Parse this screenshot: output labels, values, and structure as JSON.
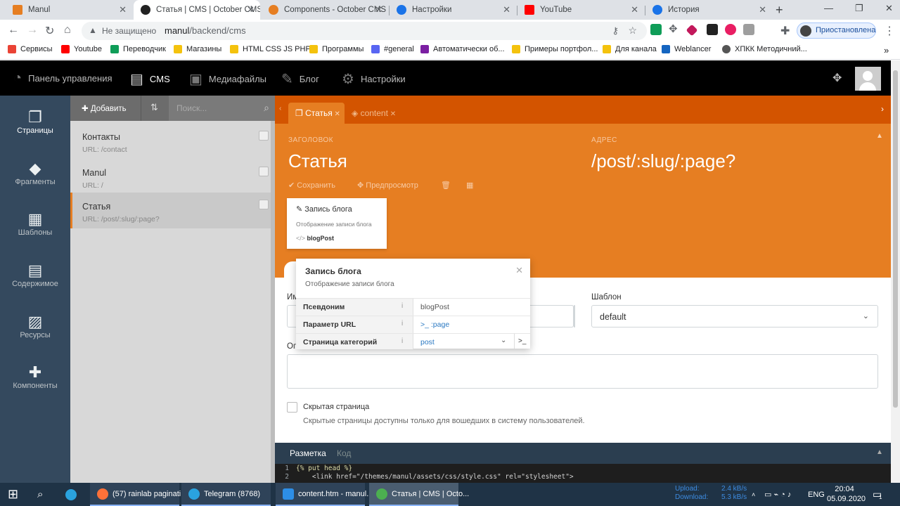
{
  "browser": {
    "tabs": [
      {
        "title": "Manul",
        "color": "#e67e22"
      },
      {
        "title": "Статья | CMS | October CMS",
        "color": "#222222"
      },
      {
        "title": "Components - October CMS",
        "color": "#e67e22"
      },
      {
        "title": "Настройки",
        "color": "#1a73e8"
      },
      {
        "title": "YouTube",
        "color": "#ff0000"
      },
      {
        "title": "История",
        "color": "#1a73e8"
      }
    ],
    "address": {
      "security": "Не защищено",
      "host": "manul",
      "path": "/backend/cms"
    },
    "profile_label": "Приостановлена",
    "bookmarks": [
      {
        "label": "Сервисы",
        "color": "#ea4335"
      },
      {
        "label": "Youtube",
        "color": "#ff0000"
      },
      {
        "label": "Переводчик",
        "color": "#0f9d58"
      },
      {
        "label": "Магазины",
        "color": "#f4c20d"
      },
      {
        "label": "HTML CSS JS PHP",
        "color": "#f4c20d"
      },
      {
        "label": "Программы",
        "color": "#f4c20d"
      },
      {
        "label": "#general",
        "color": "#5865f2"
      },
      {
        "label": "Автоматически об...",
        "color": "#7b1fa2"
      },
      {
        "label": "Примеры портфол...",
        "color": "#f4c20d"
      },
      {
        "label": "Для канала",
        "color": "#f4c20d"
      },
      {
        "label": "Weblancer",
        "color": "#1565c0"
      },
      {
        "label": "ХПКК Методичний...",
        "color": "#555555"
      }
    ]
  },
  "topnav": {
    "items": [
      {
        "label": "Панель управления",
        "icon": "dashboard-icon"
      },
      {
        "label": "CMS",
        "icon": "cms-icon"
      },
      {
        "label": "Медиафайлы",
        "icon": "media-icon"
      },
      {
        "label": "Блог",
        "icon": "blog-icon"
      },
      {
        "label": "Настройки",
        "icon": "settings-icon"
      }
    ]
  },
  "sidebar": {
    "items": [
      {
        "label": "Страницы",
        "icon": "pages-icon"
      },
      {
        "label": "Фрагменты",
        "icon": "partials-icon"
      },
      {
        "label": "Шаблоны",
        "icon": "layouts-icon"
      },
      {
        "label": "Содержимое",
        "icon": "content-icon"
      },
      {
        "label": "Ресурсы",
        "icon": "assets-icon"
      },
      {
        "label": "Компоненты",
        "icon": "components-icon"
      }
    ]
  },
  "list": {
    "add_label": "Добавить",
    "search_placeholder": "Поиск...",
    "pages": [
      {
        "title": "Контакты",
        "url": "URL: /contact"
      },
      {
        "title": "Manul",
        "url": "URL: /"
      },
      {
        "title": "Статья",
        "url": "URL: /post/:slug/:page?"
      }
    ]
  },
  "editor": {
    "tabs": [
      {
        "label": "Статья"
      },
      {
        "label": "content"
      }
    ],
    "title_label": "ЗАГОЛОВОК",
    "title_value": "Статья",
    "url_label": "АДРЕС",
    "url_value": "/post/:slug/:page?",
    "save_label": "Сохранить",
    "preview_label": "Предпросмотр",
    "component": {
      "title": "Запись блога",
      "description": "Отображение записи блога",
      "alias": "blogPost"
    },
    "fields": {
      "name_label": "Им",
      "layout_label": "Шаблон",
      "layout_value": "default",
      "description_label": "Оп",
      "hidden_label": "Скрытая страница",
      "hidden_help": "Скрытые страницы доступны только для вошедших в систему пользователей."
    },
    "code_tabs": {
      "markup": "Разметка",
      "code": "Код"
    },
    "code_lines": [
      {
        "num": "1",
        "text": "{% put head %}"
      },
      {
        "num": "2",
        "text": "    <link href=\"/themes/manul/assets/css/style.css\" rel=\"stylesheet\">"
      }
    ]
  },
  "popup": {
    "title": "Запись блога",
    "description": "Отображение записи блога",
    "rows": [
      {
        "key": "Псевдоним",
        "value": "blogPost"
      },
      {
        "key": "Параметр URL",
        "value": ">_ :page"
      },
      {
        "key": "Страница категорий",
        "value": "post"
      }
    ]
  },
  "taskbar": {
    "windows": [
      {
        "label": "(57) rainlab paginati...",
        "color": "#ff7139"
      },
      {
        "label": "Telegram (8768)",
        "color": "#2aa3df"
      },
      {
        "label": "content.htm - manul...",
        "color": "#2d8ee6"
      },
      {
        "label": "Статья | CMS | Octo...",
        "color": "#4caf50"
      }
    ],
    "upload_label": "Upload:",
    "upload_value": "2.4 kB/s",
    "download_label": "Download:",
    "download_value": "5.3 kB/s",
    "lang": "ENG",
    "time": "20:04",
    "date": "05.09.2020",
    "notifications": "1"
  }
}
